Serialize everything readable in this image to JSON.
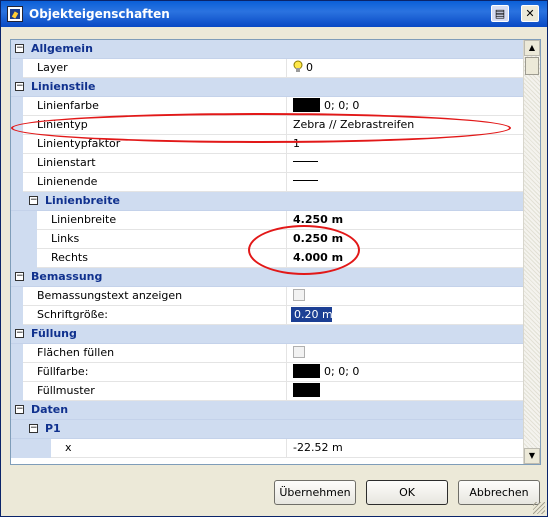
{
  "window": {
    "title": "Objekteigenschaften",
    "print_glyph": "▤",
    "close_glyph": "✕"
  },
  "grid": {
    "rows": [
      {
        "kind": "cat",
        "level": 0,
        "label": "Allgemein",
        "toggle": "−"
      },
      {
        "kind": "prop",
        "level": 0,
        "name": "Layer",
        "value": "0",
        "value_type": "layer"
      },
      {
        "kind": "cat",
        "level": 0,
        "label": "Linienstile",
        "toggle": "−"
      },
      {
        "kind": "prop",
        "level": 0,
        "name": "Linienfarbe",
        "value": "0; 0; 0",
        "value_type": "color"
      },
      {
        "kind": "prop",
        "level": 0,
        "name": "Linientyp",
        "value": "Zebra // Zebrastreifen",
        "value_type": "text"
      },
      {
        "kind": "prop",
        "level": 0,
        "name": "Linientypfaktor",
        "value": "1",
        "value_type": "text"
      },
      {
        "kind": "prop",
        "level": 0,
        "name": "Linienstart",
        "value": "",
        "value_type": "line"
      },
      {
        "kind": "prop",
        "level": 0,
        "name": "Linienende",
        "value": "",
        "value_type": "line"
      },
      {
        "kind": "cat",
        "level": 1,
        "label": "Linienbreite",
        "toggle": "−"
      },
      {
        "kind": "prop",
        "level": 1,
        "name": "Linienbreite",
        "value": "4.250 m",
        "value_type": "bold"
      },
      {
        "kind": "prop",
        "level": 1,
        "name": "Links",
        "value": "0.250 m",
        "value_type": "bold"
      },
      {
        "kind": "prop",
        "level": 1,
        "name": "Rechts",
        "value": "4.000 m",
        "value_type": "bold"
      },
      {
        "kind": "cat",
        "level": 0,
        "label": "Bemassung",
        "toggle": "−"
      },
      {
        "kind": "prop",
        "level": 0,
        "name": "Bemassungstext anzeigen",
        "value": "",
        "value_type": "check"
      },
      {
        "kind": "prop",
        "level": 0,
        "name": "Schriftgröße:",
        "value": "0.20 m",
        "value_type": "selected"
      },
      {
        "kind": "cat",
        "level": 0,
        "label": "Füllung",
        "toggle": "−"
      },
      {
        "kind": "prop",
        "level": 0,
        "name": "Flächen füllen",
        "value": "",
        "value_type": "check"
      },
      {
        "kind": "prop",
        "level": 0,
        "name": "Füllfarbe:",
        "value": "0; 0; 0",
        "value_type": "color"
      },
      {
        "kind": "prop",
        "level": 0,
        "name": "Füllmuster",
        "value": "",
        "value_type": "swatch"
      },
      {
        "kind": "cat",
        "level": 0,
        "label": "Daten",
        "toggle": "−"
      },
      {
        "kind": "cat",
        "level": 1,
        "label": "P1",
        "toggle": "−"
      },
      {
        "kind": "prop",
        "level": 2,
        "name": "x",
        "value": "-22.52 m",
        "value_type": "text"
      }
    ]
  },
  "scrollbar": {
    "up_glyph": "▲",
    "down_glyph": "▼"
  },
  "buttons": {
    "apply": "Übernehmen",
    "ok": "OK",
    "cancel": "Abbrechen"
  },
  "colors": {
    "titlebar": "#0a5fd8",
    "category_bg": "#cfdcf0",
    "category_text": "#10318e",
    "selection": "#1c3f94",
    "annotation": "#e21818"
  },
  "icons": {
    "layer": "lightbulb-icon",
    "window": "properties-icon",
    "print": "print-icon",
    "close": "close-icon"
  }
}
